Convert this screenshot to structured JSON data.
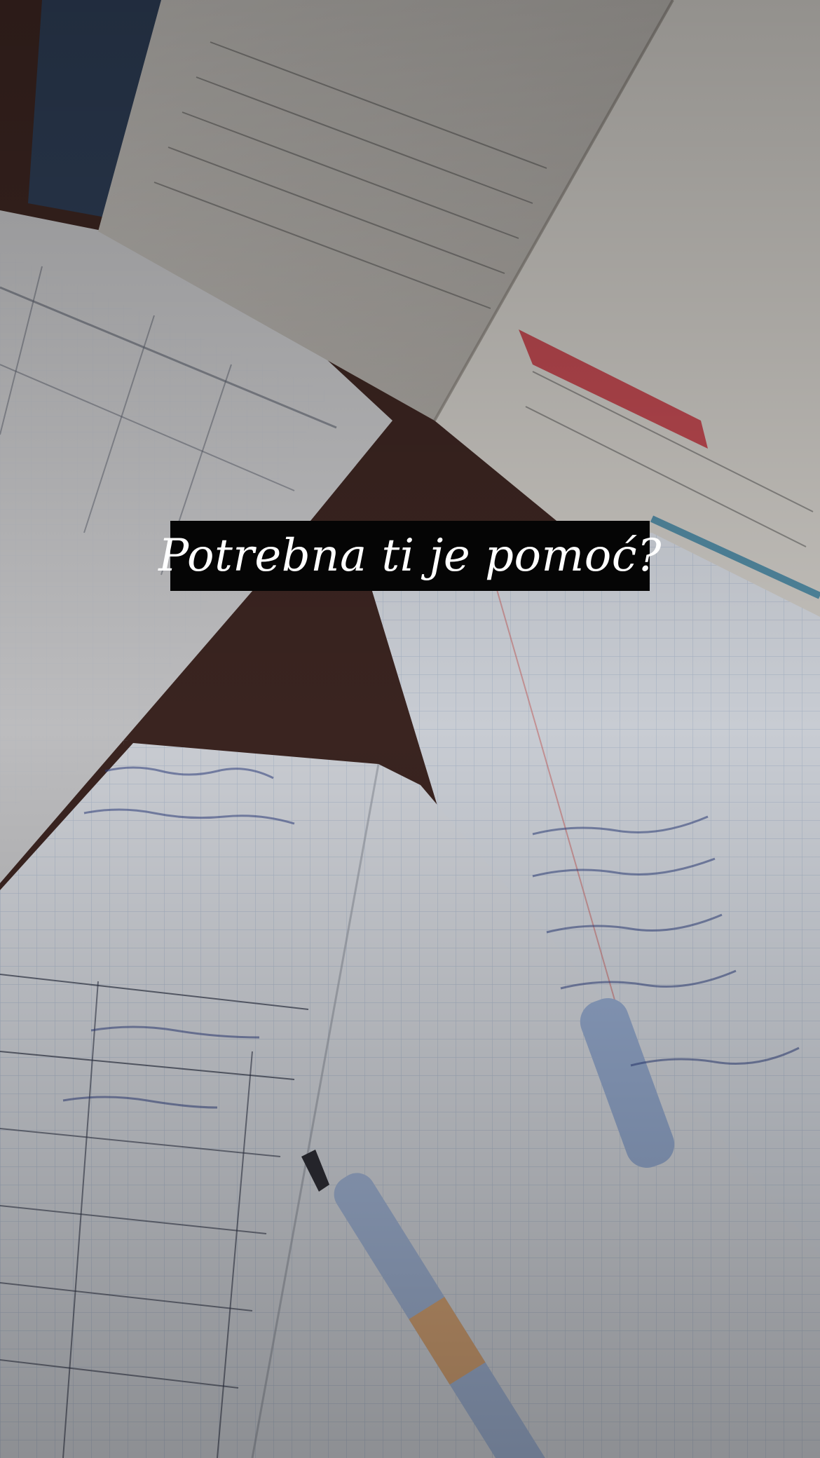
{
  "story": {
    "caption": "Potrebna ti je pomoć?"
  },
  "colors": {
    "caption_background": "#050505",
    "caption_text": "#ffffff",
    "desk": "#3a2420",
    "paper": "#cfcfd3",
    "pen_blue": "#8ea2c4"
  }
}
